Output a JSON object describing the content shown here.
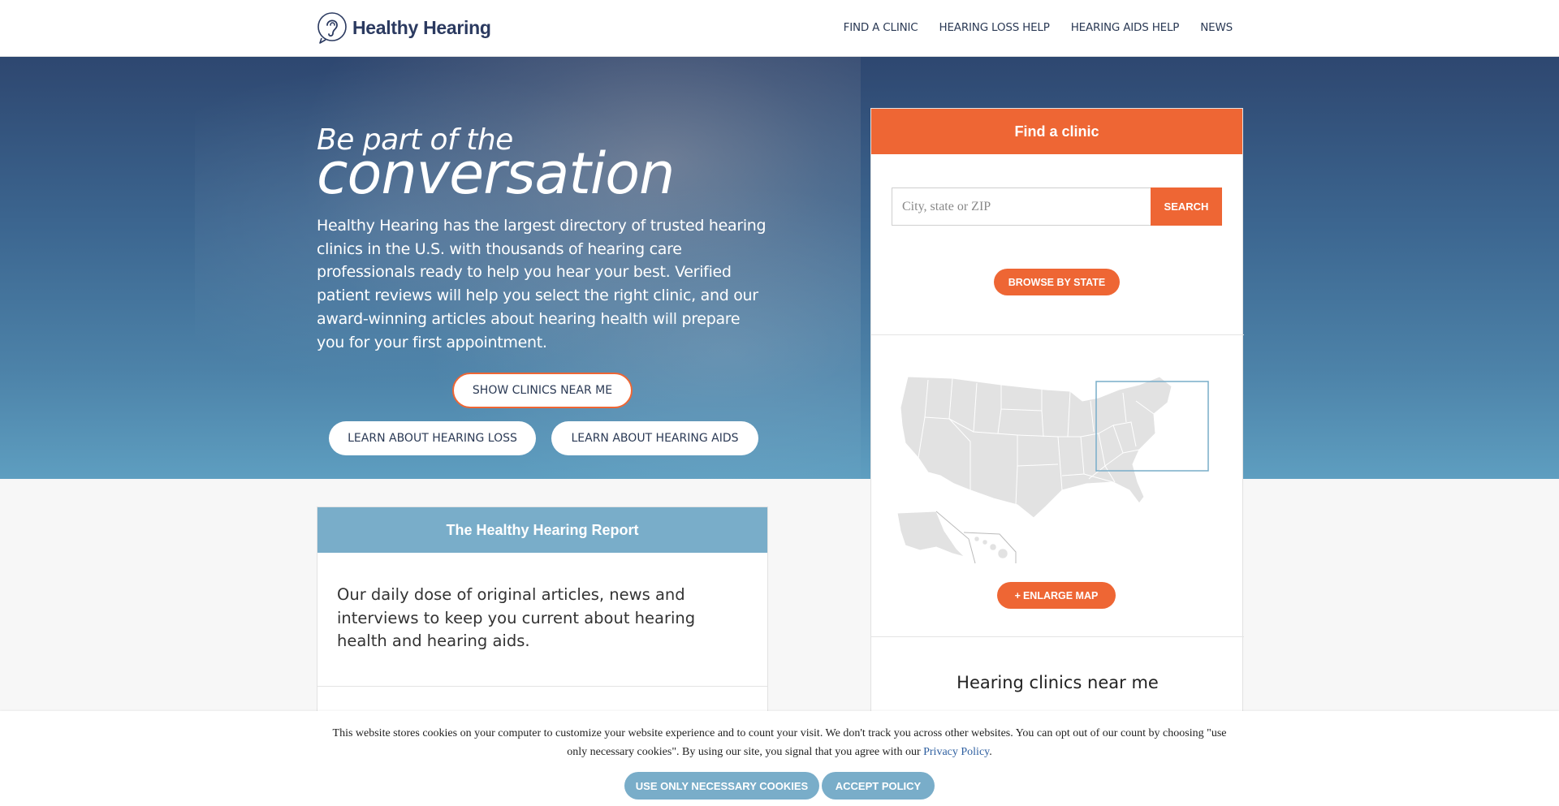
{
  "header": {
    "logo_text": "Healthy Hearing",
    "nav": [
      "FIND A CLINIC",
      "HEARING LOSS HELP",
      "HEARING AIDS HELP",
      "NEWS"
    ]
  },
  "hero": {
    "tagline_small": "Be part of the",
    "tagline_large": "conversation",
    "description": "Healthy Hearing has the largest directory of trusted hearing clinics in the U.S. with thousands of hearing care professionals ready to help you hear your best. Verified patient reviews will help you select the right clinic, and our award-winning articles about hearing health will prepare you for your first appointment.",
    "show_clinics_label": "SHOW CLINICS NEAR ME",
    "learn_loss_label": "LEARN ABOUT HEARING LOSS",
    "learn_aids_label": "LEARN ABOUT HEARING AIDS"
  },
  "find_clinic": {
    "title": "Find a clinic",
    "search_placeholder": "City, state or ZIP",
    "search_label": "SEARCH",
    "browse_label": "BROWSE BY STATE",
    "enlarge_label": "ENLARGE MAP",
    "near_me_title": "Hearing clinics near me"
  },
  "report": {
    "title": "The Healthy Hearing Report",
    "description": "Our daily dose of original articles, news and interviews to keep you current about hearing health and hearing aids."
  },
  "cookie": {
    "text": "This website stores cookies on your computer to customize your website experience and to count your visit. We don't track you across other websites. You can opt out of our count by choosing \"use only necessary cookies\". By using our site, you signal that you agree with our",
    "link": "Privacy Policy",
    "suffix": ".",
    "necessary_label": "USE ONLY NECESSARY COOKIES",
    "accept_label": "ACCEPT POLICY"
  },
  "colors": {
    "accent_orange": "#ee6634",
    "accent_blue": "#79adc9",
    "navy": "#2b3a60"
  }
}
